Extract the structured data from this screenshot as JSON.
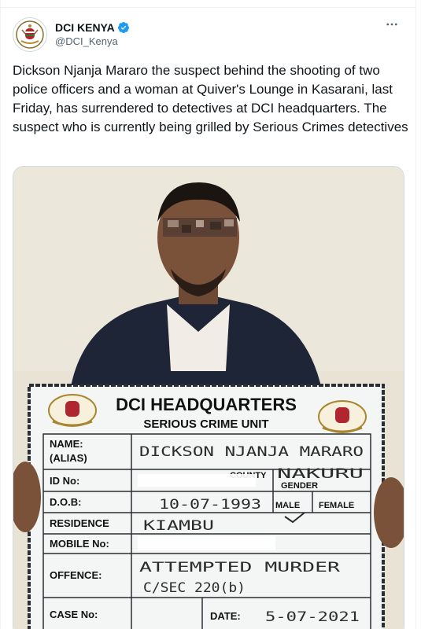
{
  "tweet": {
    "display_name": "DCI KENYA",
    "verified": true,
    "handle": "@DCI_Kenya",
    "more_icon": "more-horizontal-icon",
    "text": "Dickson Njanja Mararo the suspect behind the shooting of two police officers and a woman at Quiver's Lounge in Kasarani, last Friday, has surrendered to detectives at DCI headquarters. The suspect who is currently being grilled by Serious Crimes detectives"
  },
  "placard": {
    "title": "DCI HEADQUARTERS",
    "subtitle": "SERIOUS CRIME UNIT",
    "name_label": "NAME:",
    "alias_label": "(ALIAS)",
    "name_value": "DICKSON NJANJA MARARO",
    "county_label": "COUNTY",
    "county_value": "NAKURU",
    "gender_label": "GENDER",
    "id_label": "ID No:",
    "dob_label": "D.O.B:",
    "dob_value": "10-07-1993",
    "male_label": "MALE",
    "female_label": "FEMALE",
    "residence_label": "RESIDENCE",
    "residence_value": "KIAMBU",
    "mobile_label": "MOBILE No:",
    "offence_label": "OFFENCE:",
    "offence_value": "ATTEMPTED MURDER",
    "offence_section": "C/SEC 220(b)",
    "case_label": "CASE No:",
    "date_label": "DATE:",
    "date_value": "5-07-2021"
  },
  "colors": {
    "verified_badge": "#1d9bf0",
    "text": "#0f1419",
    "secondary": "#536471",
    "wall": "#e9e3d6",
    "jacket": "#1d2536",
    "placard_bg": "#f4f6f5"
  }
}
